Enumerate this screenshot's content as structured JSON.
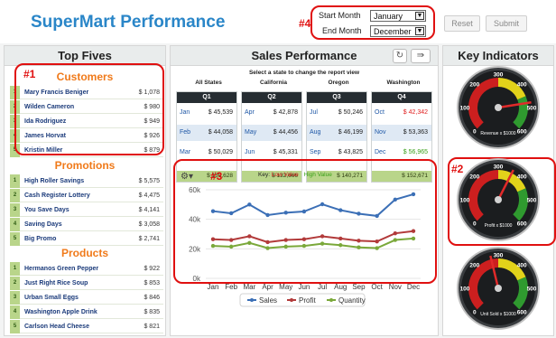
{
  "app": {
    "title": "SuperMart Performance"
  },
  "annotations": {
    "a1": "#1",
    "a2": "#2",
    "a3": "#3",
    "a4": "#4"
  },
  "filters": {
    "start_label": "Start Month",
    "start_value": "January",
    "end_label": "End Month",
    "end_value": "December",
    "reset": "Reset",
    "submit": "Submit"
  },
  "top_fives": {
    "title": "Top Fives",
    "customers": {
      "title": "Customers",
      "rows": [
        {
          "n": "1",
          "name": "Mary Francis Beniger",
          "val": "$ 1,078"
        },
        {
          "n": "2",
          "name": "Wilden Cameron",
          "val": "$ 980"
        },
        {
          "n": "3",
          "name": "Ida Rodriguez",
          "val": "$ 949"
        },
        {
          "n": "4",
          "name": "James Horvat",
          "val": "$ 926"
        },
        {
          "n": "5",
          "name": "Kristin Miller",
          "val": "$ 879"
        }
      ]
    },
    "promotions": {
      "title": "Promotions",
      "rows": [
        {
          "n": "1",
          "name": "High Roller Savings",
          "val": "$ 5,575"
        },
        {
          "n": "2",
          "name": "Cash Register Lottery",
          "val": "$ 4,475"
        },
        {
          "n": "3",
          "name": "You Save Days",
          "val": "$ 4,141"
        },
        {
          "n": "4",
          "name": "Saving Days",
          "val": "$ 3,058"
        },
        {
          "n": "5",
          "name": "Big Promo",
          "val": "$ 2,741"
        }
      ]
    },
    "products": {
      "title": "Products",
      "rows": [
        {
          "n": "1",
          "name": "Hermanos Green Pepper",
          "val": "$ 922"
        },
        {
          "n": "2",
          "name": "Just Right Rice Soup",
          "val": "$ 853"
        },
        {
          "n": "3",
          "name": "Urban Small Eggs",
          "val": "$ 846"
        },
        {
          "n": "4",
          "name": "Washington Apple Drink",
          "val": "$ 835"
        },
        {
          "n": "5",
          "name": "Carlson Head Cheese",
          "val": "$ 821"
        }
      ]
    }
  },
  "sales": {
    "title": "Sales Performance",
    "hint": "Select a state to change the report view",
    "states": [
      "All States",
      "California",
      "Oregon",
      "Washington"
    ],
    "quarters": [
      {
        "label": "Q1",
        "rows": [
          {
            "m": "Jan",
            "v": "$ 45,539"
          },
          {
            "m": "Feb",
            "v": "$ 44,058"
          },
          {
            "m": "Mar",
            "v": "$ 50,029"
          }
        ],
        "total": "$ 139,628"
      },
      {
        "label": "Q2",
        "rows": [
          {
            "m": "Apr",
            "v": "$ 42,878"
          },
          {
            "m": "May",
            "v": "$ 44,456"
          },
          {
            "m": "Jun",
            "v": "$ 45,331"
          }
        ],
        "total": "$ 132,666"
      },
      {
        "label": "Q3",
        "rows": [
          {
            "m": "Jul",
            "v": "$ 50,246"
          },
          {
            "m": "Aug",
            "v": "$ 46,199"
          },
          {
            "m": "Sep",
            "v": "$ 43,825"
          }
        ],
        "total": "$ 140,271"
      },
      {
        "label": "Q4",
        "rows": [
          {
            "m": "Oct",
            "v": "$ 42,342"
          },
          {
            "m": "Nov",
            "v": "$ 53,363"
          },
          {
            "m": "Dec",
            "v": "$ 56,965"
          }
        ],
        "total": "$ 152,671"
      }
    ],
    "key_label": "Key:",
    "key_low": "Low Value",
    "key_high": "High Value",
    "colors": {
      "low": "#e02020",
      "high": "#3aa01a"
    }
  },
  "chart_data": {
    "type": "line",
    "categories": [
      "Jan",
      "Feb",
      "Mar",
      "Apr",
      "May",
      "Jun",
      "Jul",
      "Aug",
      "Sep",
      "Oct",
      "Nov",
      "Dec"
    ],
    "series": [
      {
        "name": "Sales",
        "color": "#3b6fb6",
        "values": [
          45500,
          44100,
          50000,
          42900,
          44500,
          45300,
          50200,
          46200,
          43800,
          42300,
          53400,
          57000
        ]
      },
      {
        "name": "Profit",
        "color": "#b23a3a",
        "values": [
          26500,
          26000,
          28500,
          24500,
          26000,
          26500,
          28500,
          27000,
          25500,
          25000,
          30500,
          32000
        ]
      },
      {
        "name": "Quantity",
        "color": "#7aa83a",
        "values": [
          22000,
          21500,
          24000,
          20500,
          21500,
          22000,
          23500,
          22500,
          21000,
          20500,
          26000,
          27000
        ]
      }
    ],
    "ylim": [
      0,
      60000
    ],
    "yticks": [
      "0k",
      "20k",
      "40k",
      "60k"
    ],
    "ytick_values": [
      0,
      20000,
      40000,
      60000
    ]
  },
  "indicators": {
    "title": "Key Indicators",
    "gauges": [
      {
        "label": "Revenue x $1000",
        "value": 480,
        "min": 0,
        "max": 600,
        "labels": [
          "0",
          "100",
          "200",
          "300",
          "400",
          "500",
          "600"
        ]
      },
      {
        "label": "Profit x $1000",
        "value": 360,
        "min": 0,
        "max": 600,
        "labels": [
          "0",
          "100",
          "200",
          "300",
          "400",
          "500",
          "600"
        ]
      },
      {
        "label": "Unit Sold x $1000",
        "value": 270,
        "min": 0,
        "max": 600,
        "labels": [
          "0",
          "100",
          "200",
          "300",
          "400",
          "500",
          "600"
        ]
      }
    ]
  }
}
